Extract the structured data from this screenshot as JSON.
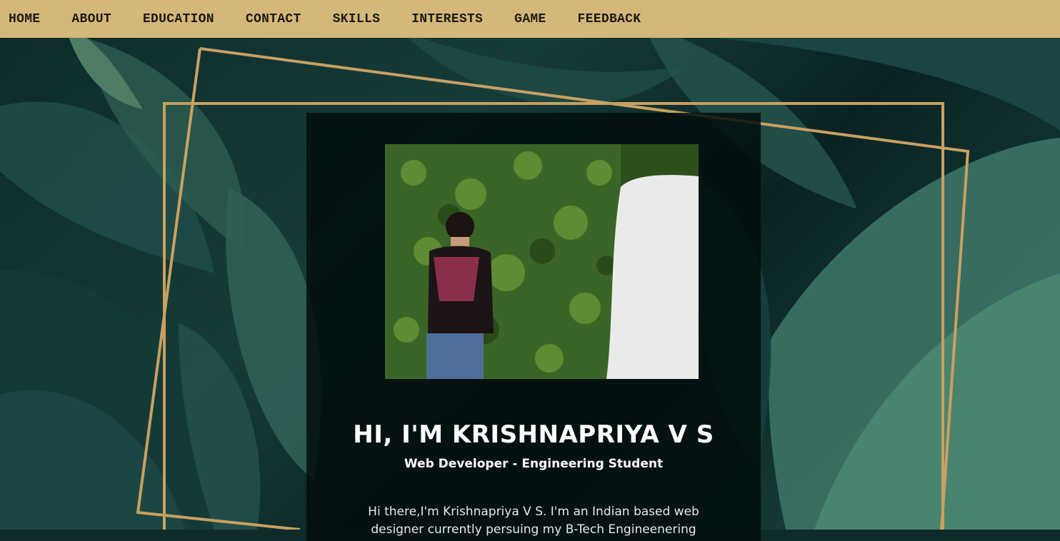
{
  "nav": {
    "items": [
      {
        "label": "HOME"
      },
      {
        "label": "ABOUT"
      },
      {
        "label": "EDUCATION"
      },
      {
        "label": "CONTACT"
      },
      {
        "label": "SKILLS"
      },
      {
        "label": "INTERESTS"
      },
      {
        "label": "GAME"
      },
      {
        "label": "FEEDBACK"
      }
    ]
  },
  "hero": {
    "name": "HI, I'M KRISHNAPRIYA V S",
    "role": "Web Developer - Engineering Student",
    "intro": "Hi there,I'm Krishnapriya V S. I'm an Indian based web designer currently persuing my B-Tech Engineenering"
  },
  "colors": {
    "nav_bg": "#d4b87a",
    "frame": "#c9a060",
    "card_bg": "#020e0e"
  }
}
